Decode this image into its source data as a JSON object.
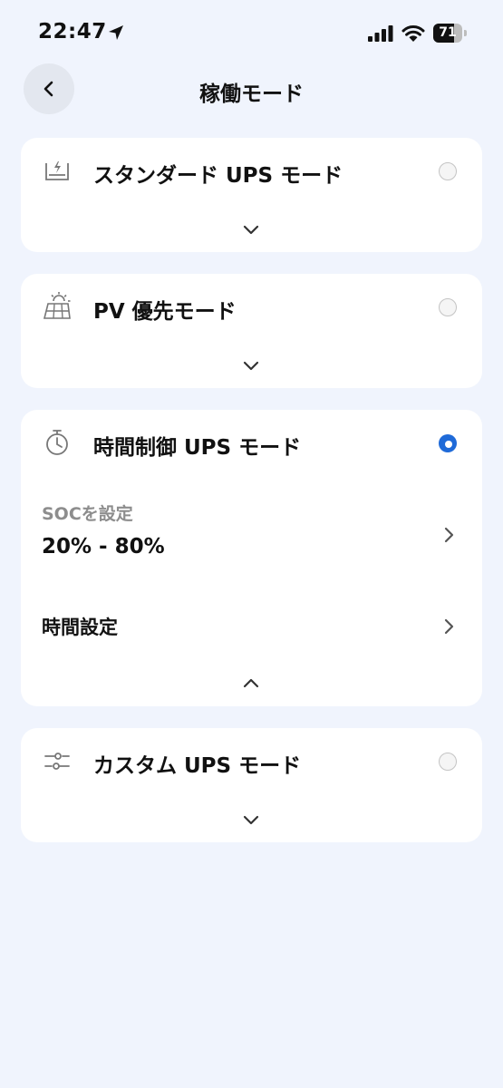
{
  "status_bar": {
    "time": "22:47",
    "battery": "71",
    "battery_level": 0.71
  },
  "header": {
    "title": "稼働モード"
  },
  "modes": [
    {
      "label": "スタンダード UPS モード",
      "icon": "ups-battery-icon",
      "selected": false,
      "expanded": false
    },
    {
      "label": "PV 優先モード",
      "icon": "solar-panel-icon",
      "selected": false,
      "expanded": false
    },
    {
      "label": "時間制御 UPS モード",
      "icon": "timer-icon",
      "selected": true,
      "expanded": true,
      "soc": {
        "caption": "SOCを設定",
        "value": "20% - 80%"
      },
      "time_setting": {
        "label": "時間設定"
      }
    },
    {
      "label": "カスタム UPS モード",
      "icon": "sliders-icon",
      "selected": false,
      "expanded": false
    }
  ],
  "colors": {
    "background": "#f0f4fd",
    "accent": "#1f6ad8",
    "card": "#ffffff"
  }
}
